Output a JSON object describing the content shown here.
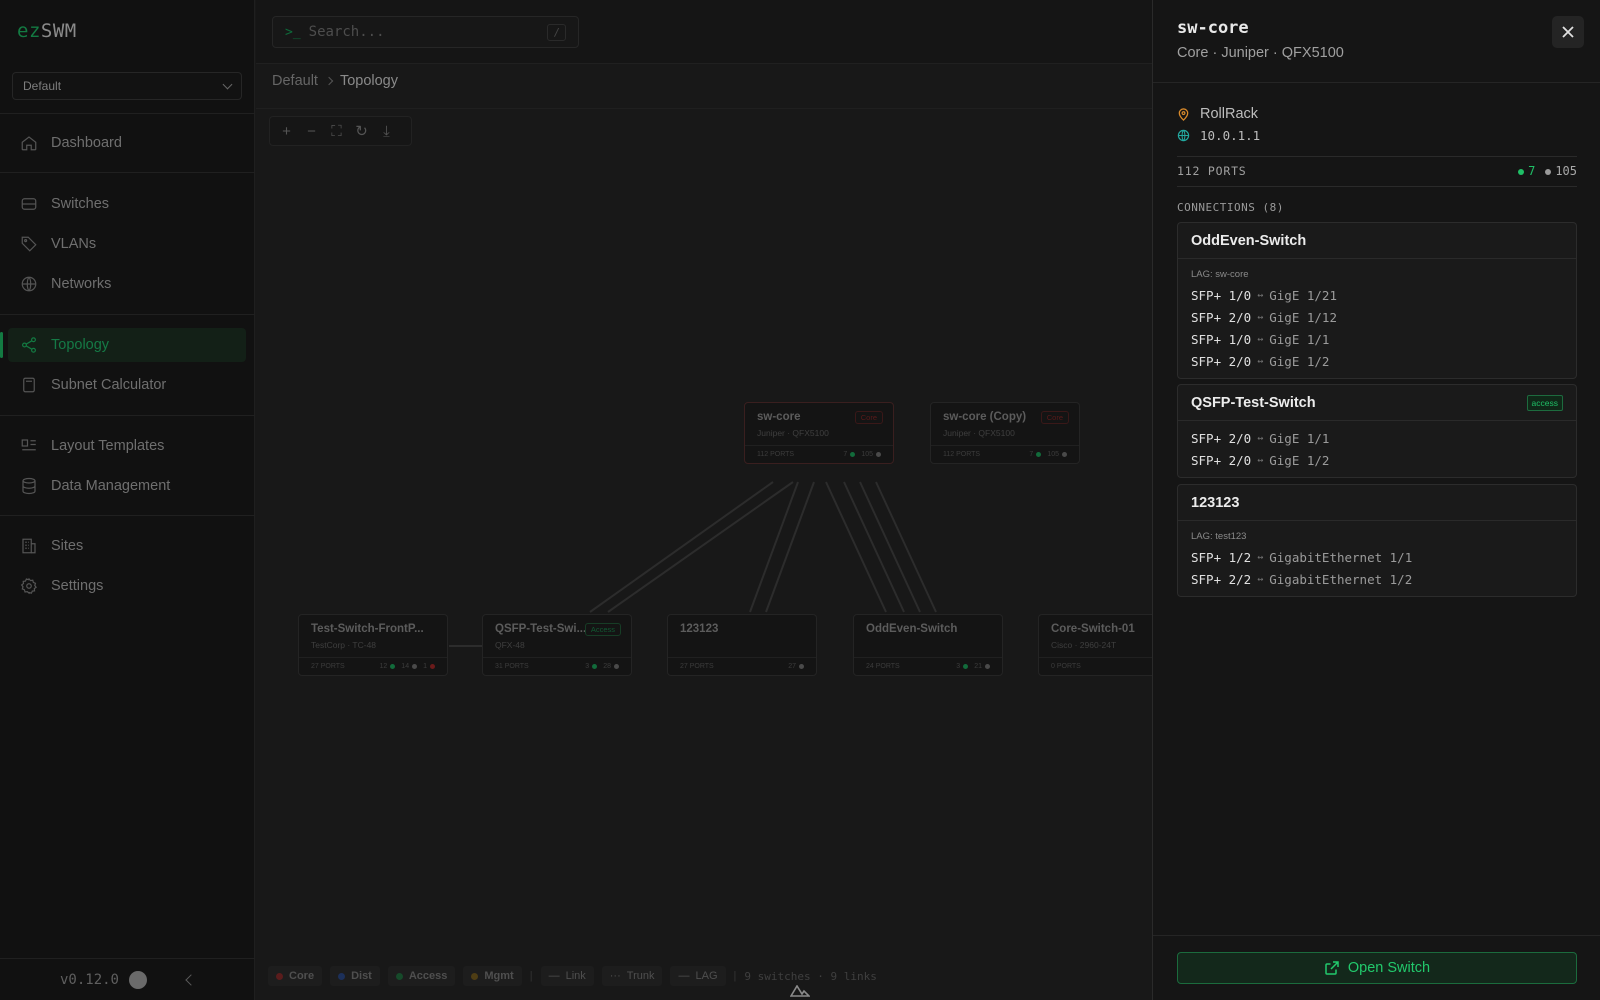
{
  "app": {
    "brand_ez": "ez",
    "brand_swm": "SWM",
    "workspace": "Default",
    "version": "v0.12.0"
  },
  "search": {
    "placeholder": "Search...",
    "prompt": ">_",
    "shortcut": "/"
  },
  "nav": [
    {
      "label": "Dashboard",
      "icon": "home-icon"
    },
    {
      "label": "Switches",
      "icon": "server-icon"
    },
    {
      "label": "VLANs",
      "icon": "tag-icon"
    },
    {
      "label": "Networks",
      "icon": "globe-icon"
    },
    {
      "label": "Topology",
      "icon": "share-icon",
      "active": true
    },
    {
      "label": "Subnet Calculator",
      "icon": "calculator-icon"
    },
    {
      "label": "Layout Templates",
      "icon": "layout-icon"
    },
    {
      "label": "Data Management",
      "icon": "database-icon"
    },
    {
      "label": "Sites",
      "icon": "building-icon"
    },
    {
      "label": "Settings",
      "icon": "gear-icon"
    }
  ],
  "breadcrumb": {
    "root": "Default",
    "current": "Topology"
  },
  "nodes": [
    {
      "name": "sw-core",
      "sub": "Juniper · QFX5100",
      "role": "Core",
      "ports": "112 PORTS",
      "up": "7",
      "down": "105"
    },
    {
      "name": "sw-core (Copy)",
      "sub": "Juniper · QFX5100",
      "role": "Core",
      "ports": "112 PORTS",
      "up": "7",
      "down": "105"
    },
    {
      "name": "Test-Switch-FrontP...",
      "sub": "TestCorp · TC-48",
      "ports": "27 PORTS",
      "up": "12",
      "down": "14",
      "err": "1"
    },
    {
      "name": "QSFP-Test-Swi...",
      "sub": "QFX-48",
      "role": "Access",
      "ports": "31 PORTS",
      "up": "3",
      "down": "28"
    },
    {
      "name": "123123",
      "sub": "",
      "ports": "27 PORTS",
      "down": "27"
    },
    {
      "name": "OddEven-Switch",
      "sub": "",
      "ports": "24 PORTS",
      "up": "3",
      "down": "21"
    },
    {
      "name": "Core-Switch-01",
      "sub": "Cisco · 2960-24T",
      "ports": "0 PORTS"
    }
  ],
  "legend": {
    "core": "Core",
    "dist": "Dist",
    "access": "Access",
    "mgmt": "Mgmt",
    "link": "Link",
    "trunk": "Trunk",
    "lag": "LAG",
    "summary": "9 switches · 9 links"
  },
  "panel": {
    "title": "sw-core",
    "subtitle": "Core · Juniper · QFX5100",
    "location": "RollRack",
    "ip": "10.0.1.1",
    "ports_label": "112 PORTS",
    "ports_up": "7",
    "ports_down": "105",
    "connections_title": "CONNECTIONS (8)",
    "cards": [
      {
        "name": "OddEven-Switch",
        "lag": "LAG: sw-core",
        "rows": [
          {
            "local": "SFP+ 1/0",
            "remote": "GigE 1/21"
          },
          {
            "local": "SFP+ 2/0",
            "remote": "GigE 1/12"
          },
          {
            "local": "SFP+ 1/0",
            "remote": "GigE 1/1"
          },
          {
            "local": "SFP+ 2/0",
            "remote": "GigE 1/2"
          }
        ]
      },
      {
        "name": "QSFP-Test-Switch",
        "badge": "access",
        "rows": [
          {
            "local": "SFP+ 2/0",
            "remote": "GigE 1/1"
          },
          {
            "local": "SFP+ 2/0",
            "remote": "GigE 1/2"
          }
        ]
      },
      {
        "name": "123123",
        "lag": "LAG: test123",
        "rows": [
          {
            "local": "SFP+ 1/2",
            "remote": "GigabitEthernet 1/1"
          },
          {
            "local": "SFP+ 2/2",
            "remote": "GigabitEthernet 1/2"
          }
        ]
      }
    ],
    "open_button": "Open Switch",
    "arrow": "↔"
  },
  "colors": {
    "accent": "#22c96c",
    "core": "#b03030",
    "dist": "#3a6bd8",
    "access": "#2a9a55",
    "mgmt": "#b08a2a"
  }
}
